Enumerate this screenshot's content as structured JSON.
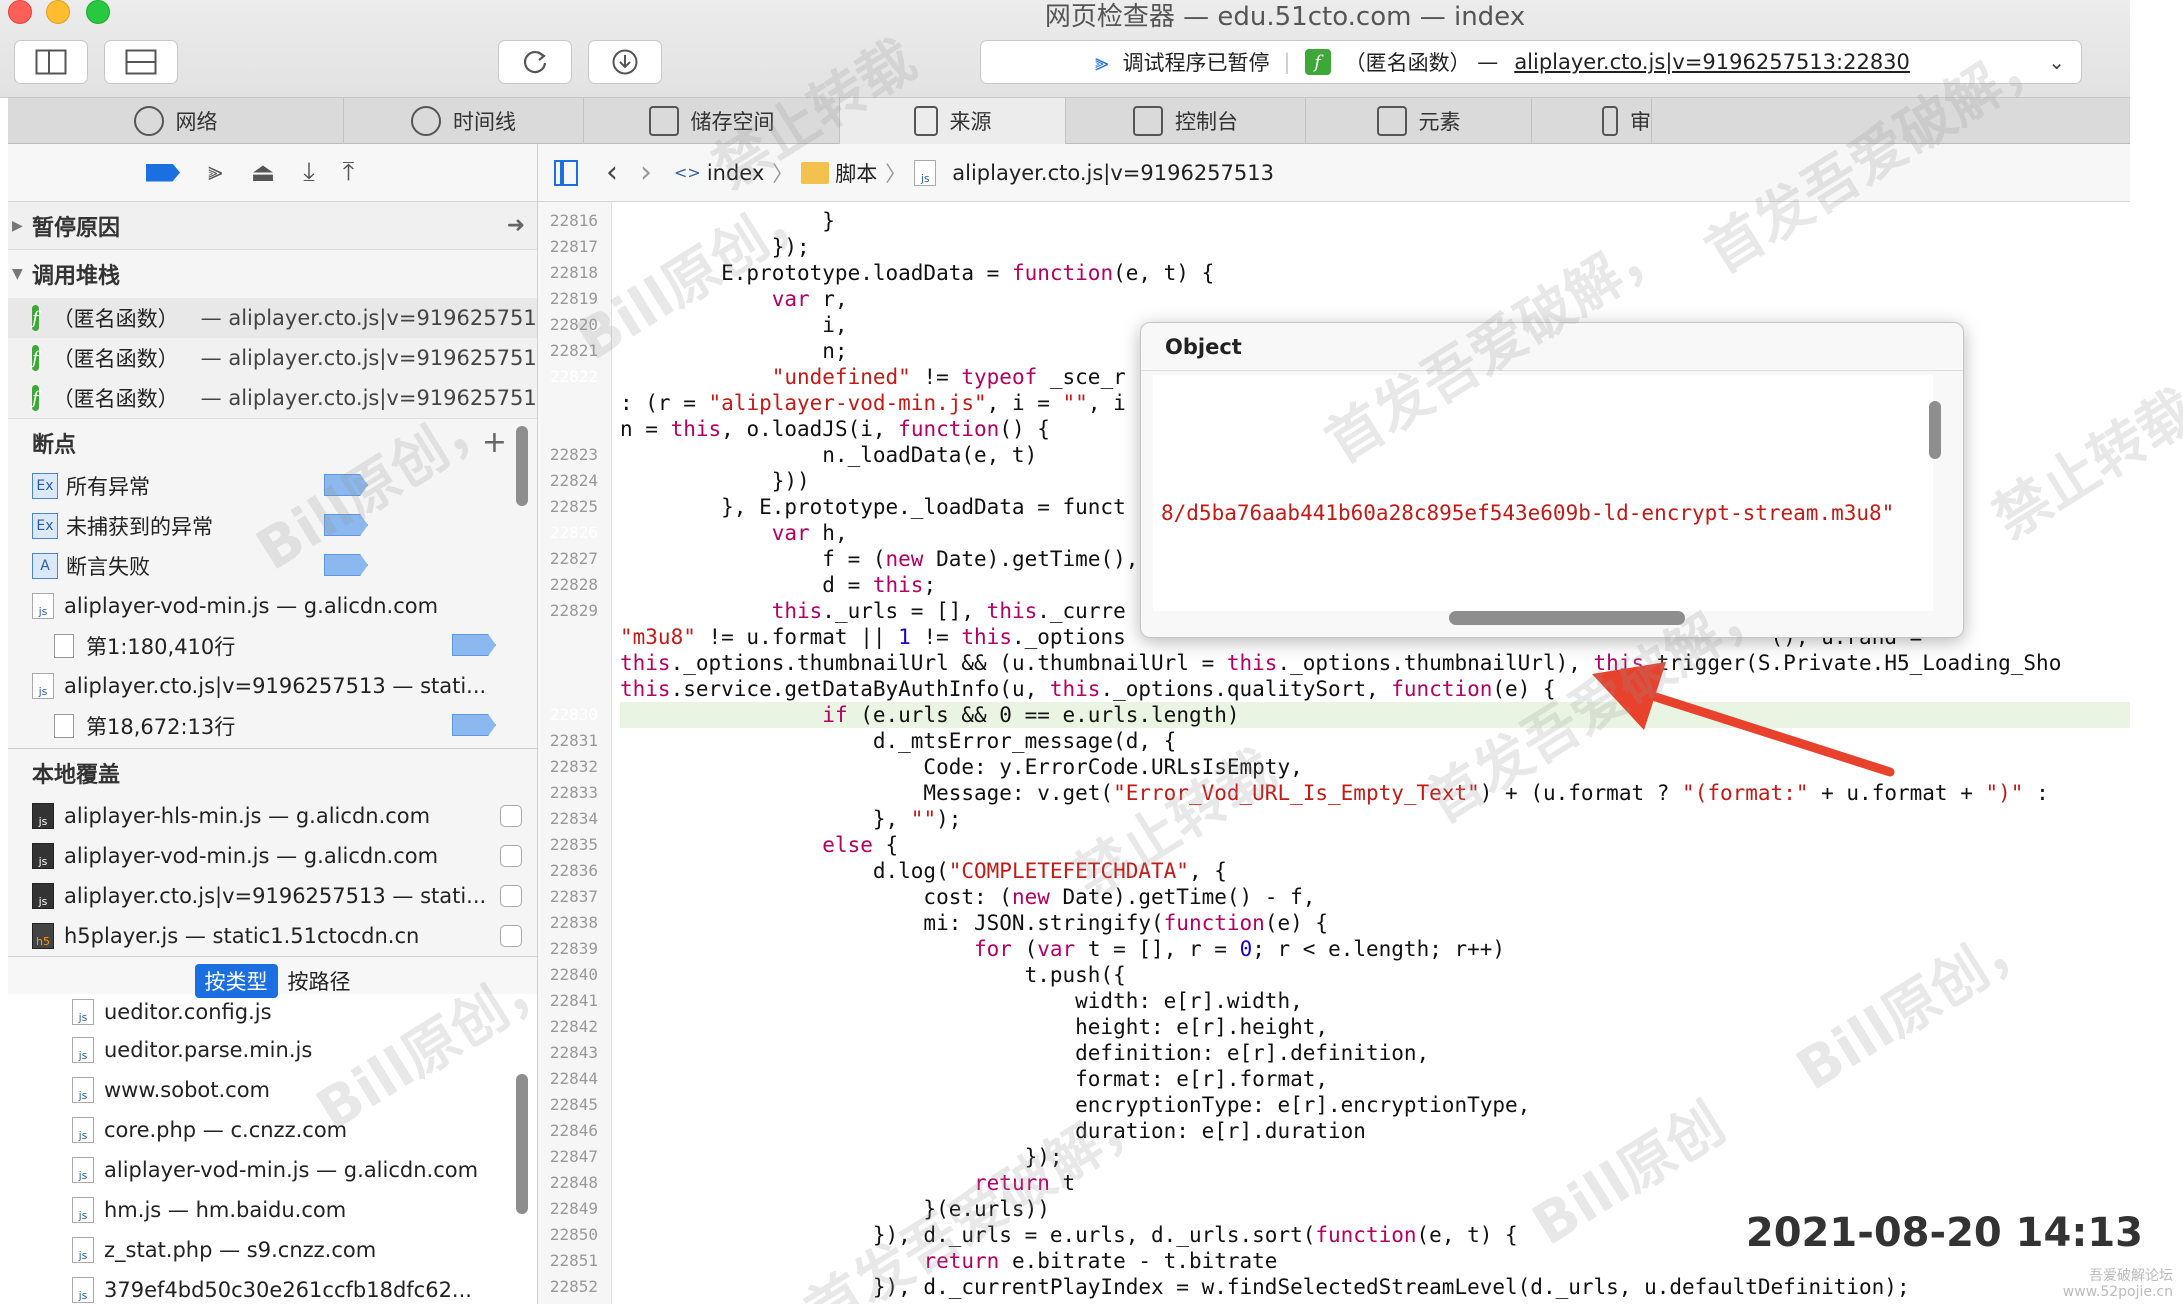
{
  "window": {
    "title": "网页检查器 — edu.51cto.com — index",
    "status_text": "调试程序已暂停",
    "paused_frame": "（匿名函数）",
    "paused_file": "aliplayer.cto.js|v=9196257513:22830"
  },
  "tabs": [
    {
      "label": "网络",
      "icon": "network-icon"
    },
    {
      "label": "时间线",
      "icon": "timeline-icon"
    },
    {
      "label": "储存空间",
      "icon": "storage-icon"
    },
    {
      "label": "来源",
      "icon": "sources-icon"
    },
    {
      "label": "控制台",
      "icon": "console-icon"
    },
    {
      "label": "元素",
      "icon": "elements-icon"
    },
    {
      "label": "审",
      "icon": "audit-icon"
    }
  ],
  "sidebar": {
    "pause_reason_header": "暂停原因",
    "call_stack_header": "调用堆栈",
    "call_stack": [
      {
        "name": "（匿名函数）",
        "location": "— aliplayer.cto.js|v=9196257513"
      },
      {
        "name": "（匿名函数）",
        "location": "— aliplayer.cto.js|v=9196257513"
      },
      {
        "name": "（匿名函数）",
        "location": "— aliplayer.cto.js|v=9196257513"
      }
    ],
    "breakpoints_header": "断点",
    "breakpoints": [
      {
        "badge": "Ex",
        "label": "所有异常"
      },
      {
        "badge": "Ex",
        "label": "未捕获到的异常"
      },
      {
        "badge": "A",
        "label": "断言失败"
      }
    ],
    "bp_files": [
      {
        "file": "aliplayer-vod-min.js — g.alicdn.com",
        "line": "第1:180,410行"
      },
      {
        "file": "aliplayer.cto.js|v=9196257513 — stati...",
        "line": "第18,672:13行"
      }
    ],
    "local_overrides_header": "本地覆盖",
    "overrides": [
      {
        "label": "aliplayer-hls-min.js — g.alicdn.com",
        "icon": "js"
      },
      {
        "label": "aliplayer-vod-min.js — g.alicdn.com",
        "icon": "js"
      },
      {
        "label": "aliplayer.cto.js|v=9196257513 — stati...",
        "icon": "js"
      },
      {
        "label": "h5player.js — static1.51ctocdn.cn",
        "icon": "h5"
      }
    ],
    "group_by_type": "按类型",
    "group_by_path": "按路径",
    "files": [
      "ueditor.config.js",
      "ueditor.parse.min.js",
      "www.sobot.com",
      "core.php — c.cnzz.com",
      "aliplayer-vod-min.js — g.alicdn.com",
      "hm.js — hm.baidu.com",
      "z_stat.php — s9.cnzz.com",
      "379ef4bd50c30e261ccfb18dfc62..."
    ]
  },
  "breadcrumb": {
    "items": [
      "index",
      "脚本",
      "aliplayer.cto.js|v=9196257513"
    ]
  },
  "editor": {
    "line_numbers": [
      "22816",
      "22817",
      "22818",
      "22819",
      "22820",
      "22821",
      "22822",
      "",
      "",
      "22823",
      "22824",
      "22825",
      "22826",
      "22827",
      "22828",
      "22829",
      "",
      "",
      "",
      "22830",
      "22831",
      "22832",
      "22833",
      "22834",
      "22835",
      "22836",
      "22837",
      "22838",
      "22839",
      "22840",
      "22841",
      "22842",
      "22843",
      "22844",
      "22845",
      "22846",
      "22847",
      "22848",
      "22849",
      "22850",
      "22851",
      "22852"
    ],
    "breakpoint_lines": [
      "22822",
      "22826"
    ],
    "current_line": "22830",
    "lines": [
      "                }",
      "            });",
      "        E.prototype.loadData = function(e, t) {",
      "            var r,",
      "                i,",
      "                n;",
      "            \"undefined\" != typeof _sce_r                                                    s._options.en",
      ": (r = \"aliplayer-vod-min.js\", i = \"\", i                                                   h5Version + \"",
      "n = this, o.loadJS(i, function() {",
      "                n._loadData(e, t)",
      "            }))",
      "        }, E.prototype._loadData = funct",
      "            var h,",
      "                f = (new Date).getTime(),",
      "                d = this;",
      "            this._urls = [], this._curre                                                    ExpiredHandle",
      "\"m3u8\" != u.format || 1 != this._options                                                   (), u.rand =",
      "this._options.thumbnailUrl && (u.thumbnailUrl = this._options.thumbnailUrl), this.trigger(S.Private.H5_Loading_Sho",
      "this.service.getDataByAuthInfo(u, this._options.qualitySort, function(e) {",
      "                if (e.urls && 0 == e.urls.length)",
      "                    d._mtsError_message(d, {",
      "                        Code: y.ErrorCode.URLsIsEmpty,",
      "                        Message: v.get(\"Error_Vod_URL_Is_Empty_Text\") + (u.format ? \"(format:\" + u.format + \")\" :",
      "                    }, \"\");",
      "                else {",
      "                    d.log(\"COMPLETEFETCHDATA\", {",
      "                        cost: (new Date).getTime() - f,",
      "                        mi: JSON.stringify(function(e) {",
      "                            for (var t = [], r = 0; r < e.length; r++)",
      "                                t.push({",
      "                                    width: e[r].width,",
      "                                    height: e[r].height,",
      "                                    definition: e[r].definition,",
      "                                    format: e[r].format,",
      "                                    encryptionType: e[r].encryptionType,",
      "                                    duration: e[r].duration",
      "                                });",
      "                            return t",
      "                        }(e.urls))",
      "                    }), d._urls = e.urls, d._urls.sort(function(e, t) {",
      "                        return e.bitrate - t.bitrate",
      "                    }), d._currentPlayIndex = w.findSelectedStreamLevel(d._urls, u.defaultDefinition);"
    ]
  },
  "popover": {
    "title": "Object",
    "value": "8/d5ba76aab441b60a28c895ef543e609b-ld-encrypt-stream.m3u8\""
  },
  "watermarks": [
    "禁止转载",
    "首发吾爱破解，",
    "Bill原创，",
    "首发吾爱破解，",
    "Bill原创，",
    "禁止转载",
    "首发吾爱破解，",
    "Bill原创，",
    "禁止转载",
    "首发吾爱破解，",
    "Bill原创，",
    "Bill原创"
  ],
  "timestamp": "2021-08-20 14:13",
  "corner_mark": [
    "吾爱破解论坛",
    "www.52pojie.cn"
  ],
  "colors": {
    "accent": "#1b6fe0",
    "annotation_arrow": "#e8412c",
    "current_line_bg": "#e9f5e2"
  }
}
